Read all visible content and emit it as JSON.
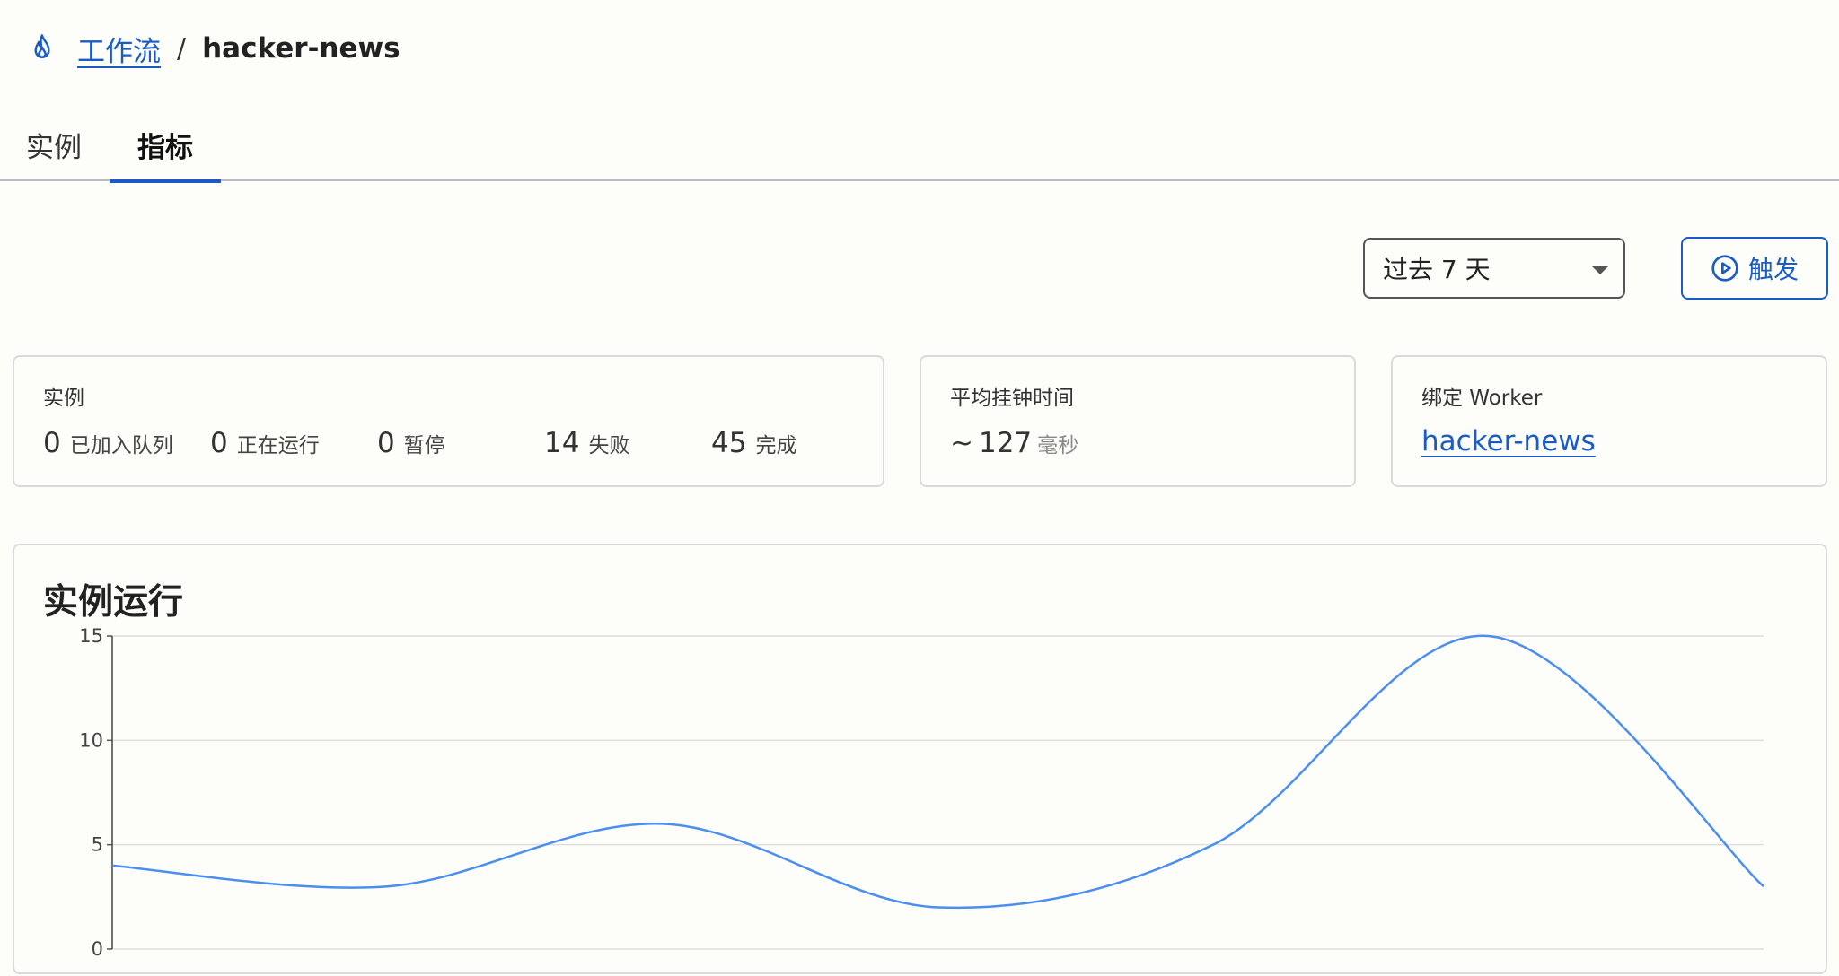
{
  "breadcrumb": {
    "root": "工作流",
    "separator": "/",
    "current": "hacker-news"
  },
  "tabs": [
    {
      "label": "实例"
    },
    {
      "label": "指标"
    }
  ],
  "controls": {
    "range": "过去 7 天",
    "trigger": "触发"
  },
  "instances_card": {
    "label": "实例",
    "stats": [
      {
        "value": "0",
        "label": "已加入队列"
      },
      {
        "value": "0",
        "label": "正在运行"
      },
      {
        "value": "0",
        "label": "暂停"
      },
      {
        "value": "14",
        "label": "失败"
      },
      {
        "value": "45",
        "label": "完成"
      }
    ]
  },
  "avg_card": {
    "label": "平均挂钟时间",
    "prefix": "~",
    "value": "127",
    "unit": "毫秒"
  },
  "worker_card": {
    "label": "绑定 Worker",
    "worker": "hacker-news"
  },
  "colors": {
    "accent": "#1a5bc4",
    "line": "#4a8ef0"
  },
  "chart_data": {
    "type": "line",
    "title": "实例运行",
    "x": [
      0,
      1,
      2,
      3,
      4,
      5,
      6
    ],
    "series": [
      {
        "values": [
          4,
          3,
          6,
          2,
          5,
          15,
          3
        ]
      }
    ],
    "ylim": [
      0,
      15
    ],
    "yticks": [
      0,
      5,
      10,
      15
    ],
    "grid": true
  }
}
